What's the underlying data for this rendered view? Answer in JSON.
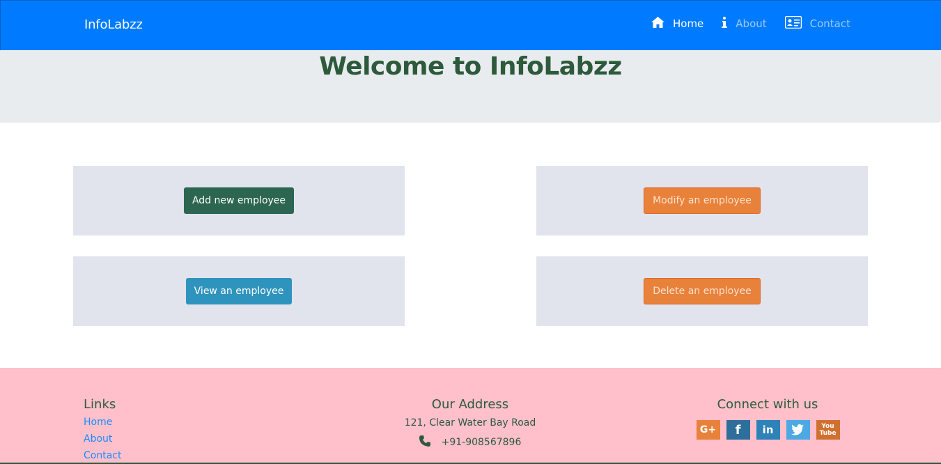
{
  "navbar": {
    "brand": "InfoLabzz",
    "items": [
      {
        "label": "Home",
        "icon": "home-icon",
        "active": true
      },
      {
        "label": "About",
        "icon": "info-icon",
        "active": false
      },
      {
        "label": "Contact",
        "icon": "contact-card-icon",
        "active": false
      }
    ]
  },
  "jumbotron": {
    "title": "Welcome to InfoLabzz"
  },
  "actions": {
    "add": "Add new employee",
    "modify": "Modify an employee",
    "view": "View an employee",
    "delete": "Delete an employee"
  },
  "footer": {
    "links_heading": "Links",
    "links": [
      "Home",
      "About",
      "Contact"
    ],
    "address_heading": "Our Address",
    "address": "121, Clear Water Bay Road",
    "phone": "+91-908567896",
    "social_heading": "Connect with us",
    "social": [
      {
        "name": "google-plus-icon",
        "glyph": "G+"
      },
      {
        "name": "facebook-icon",
        "glyph": "f"
      },
      {
        "name": "linkedin-icon",
        "glyph": "in"
      },
      {
        "name": "twitter-icon",
        "glyph": "❦"
      },
      {
        "name": "youtube-icon",
        "glyph": "You\nTube"
      }
    ]
  },
  "colors": {
    "navbar": "#007bff",
    "jumbotron": "#e9ecef",
    "footer": "#ffc0cb",
    "heading": "#2d5a3b",
    "add_button": "#2c6650",
    "modify_button": "#e8813a",
    "view_button": "#2f94bd",
    "delete_button": "#e8813a"
  }
}
